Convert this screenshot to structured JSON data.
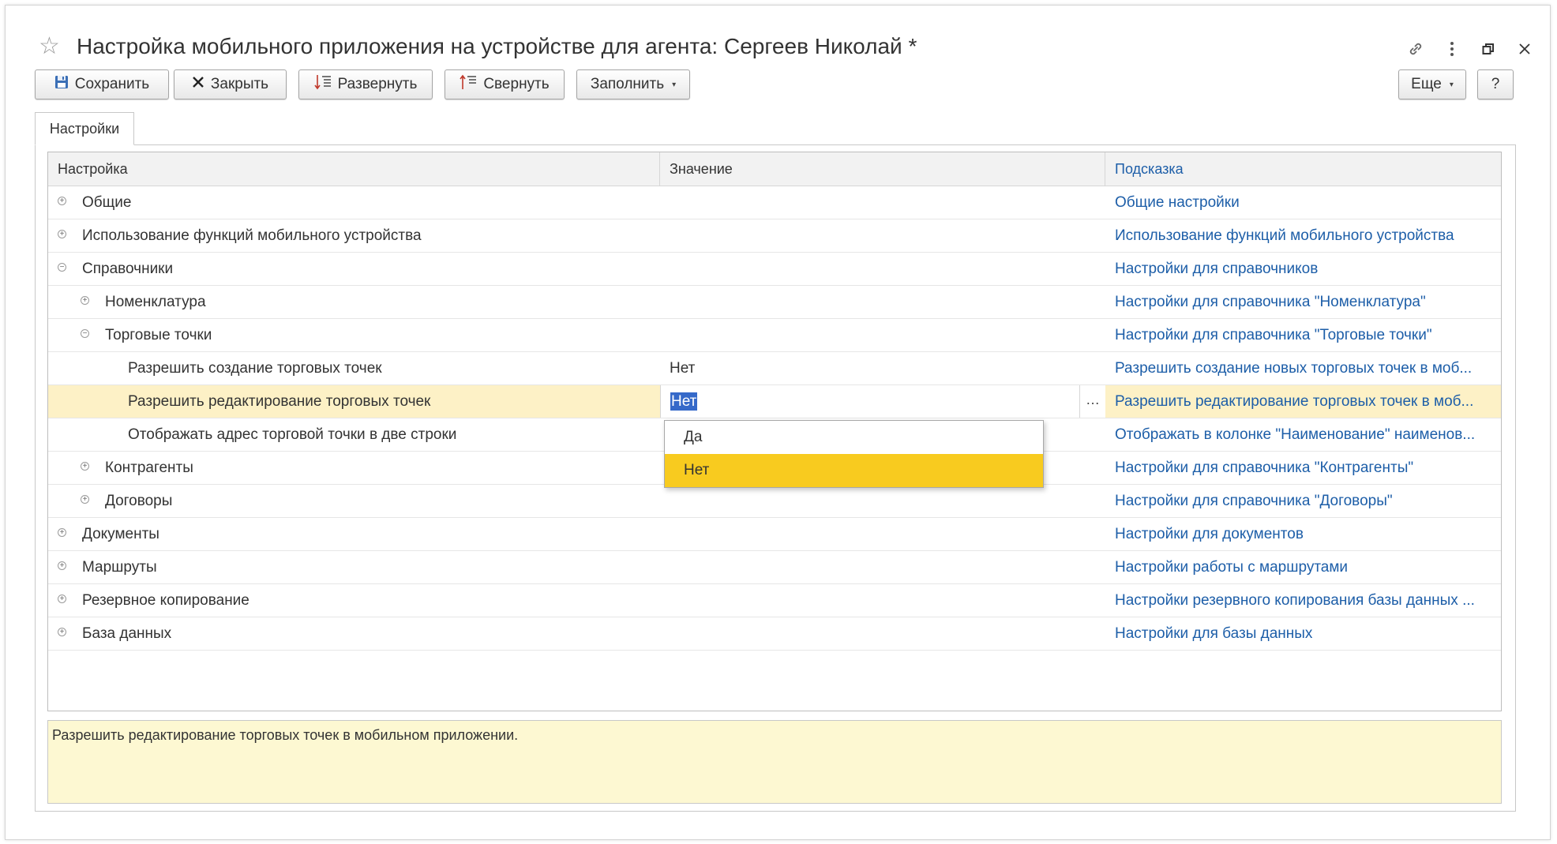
{
  "window": {
    "title": "Настройка мобильного приложения на устройстве для агента: Сергеев Николай *"
  },
  "toolbar": {
    "save_label": "Сохранить",
    "close_label": "Закрыть",
    "expand_label": "Развернуть",
    "collapse_label": "Свернуть",
    "fill_label": "Заполнить",
    "more_label": "Еще",
    "help_label": "?"
  },
  "tabs": [
    {
      "label": "Настройки",
      "active": true
    }
  ],
  "grid": {
    "columns": {
      "setting": "Настройка",
      "value": "Значение",
      "hint": "Подсказка"
    },
    "rows": [
      {
        "label": "Общие",
        "level": 0,
        "expander": "plus",
        "value": "",
        "hint": "Общие настройки"
      },
      {
        "label": "Использование функций мобильного устройства",
        "level": 0,
        "expander": "plus",
        "value": "",
        "hint": "Использование функций мобильного устройства"
      },
      {
        "label": "Справочники",
        "level": 0,
        "expander": "minus",
        "value": "",
        "hint": "Настройки для справочников"
      },
      {
        "label": "Номенклатура",
        "level": 1,
        "expander": "plus",
        "value": "",
        "hint": "Настройки для справочника \"Номенклатура\""
      },
      {
        "label": "Торговые точки",
        "level": 1,
        "expander": "minus",
        "value": "",
        "hint": "Настройки для справочника \"Торговые точки\""
      },
      {
        "label": "Разрешить создание торговых точек",
        "level": 2,
        "expander": "none",
        "value": "Нет",
        "hint": "Разрешить создание новых торговых точек в моб..."
      },
      {
        "label": "Разрешить редактирование торговых точек",
        "level": 2,
        "expander": "none",
        "value": "Нет",
        "hint": "Разрешить редактирование торговых точек в моб...",
        "selected": true,
        "editing": true
      },
      {
        "label": "Отображать адрес торговой точки в две строки",
        "level": 2,
        "expander": "none",
        "value": "",
        "hint": "Отображать в колонке \"Наименование\" наименов..."
      },
      {
        "label": "Контрагенты",
        "level": 1,
        "expander": "plus",
        "value": "",
        "hint": "Настройки для справочника \"Контрагенты\""
      },
      {
        "label": "Договоры",
        "level": 1,
        "expander": "plus",
        "value": "",
        "hint": "Настройки для справочника \"Договоры\""
      },
      {
        "label": "Документы",
        "level": 0,
        "expander": "plus",
        "value": "",
        "hint": "Настройки для документов"
      },
      {
        "label": "Маршруты",
        "level": 0,
        "expander": "plus",
        "value": "",
        "hint": "Настройки работы с маршрутами"
      },
      {
        "label": "Резервное копирование",
        "level": 0,
        "expander": "plus",
        "value": "",
        "hint": "Настройки резервного копирования базы данных ..."
      },
      {
        "label": "База данных",
        "level": 0,
        "expander": "plus",
        "value": "",
        "hint": "Настройки для базы данных"
      }
    ]
  },
  "dropdown": {
    "options": [
      "Да",
      "Нет"
    ],
    "selected": "Нет"
  },
  "description": "Разрешить редактирование торговых точек в мобильном приложении.",
  "colors": {
    "link": "#1d5ea8",
    "selected_row": "#fdf1c6",
    "dropdown_active": "#f8cb1f",
    "description_bg": "#fdf8d2",
    "edit_highlight": "#3569c9"
  }
}
